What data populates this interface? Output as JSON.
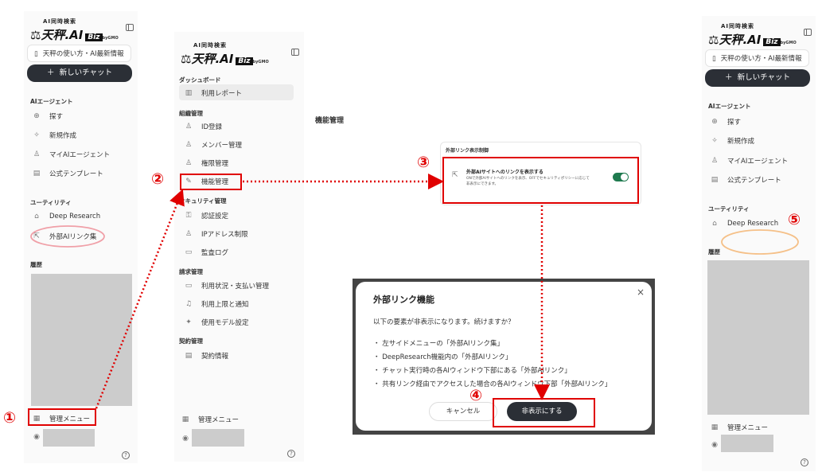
{
  "brand": {
    "small": "AI同時検索",
    "main": "天秤.AI",
    "biz": "Biz",
    "gmo": "byGMO"
  },
  "sidebar": {
    "usage_link": "天秤の使い方・AI最新情報",
    "new_chat": "新しいチャット",
    "sec_agents": "AIエージェント",
    "agents": [
      "探す",
      "新規作成",
      "マイAIエージェント",
      "公式テンプレート"
    ],
    "sec_utility": "ユーティリティ",
    "utilities": [
      "Deep Research",
      "外部AIリンク集"
    ],
    "sec_history": "履歴",
    "admin_menu": "管理メニュー",
    "help": "?"
  },
  "admin": {
    "sec_dashboard": "ダッシュボード",
    "usage_report": "利用レポート",
    "sec_org": "組織管理",
    "org_items": [
      "ID登録",
      "メンバー管理",
      "権限管理",
      "機能管理"
    ],
    "sec_security": "セキュリティ管理",
    "security_items": [
      "認証設定",
      "IPアドレス制限",
      "監査ログ"
    ],
    "sec_billing": "請求管理",
    "billing_items": [
      "利用状況・支払い管理",
      "利用上限と通知",
      "使用モデル設定"
    ],
    "sec_contract": "契約管理",
    "contract_items": [
      "契約情報"
    ],
    "admin_menu": "管理メニュー"
  },
  "feature": {
    "page_title": "機能管理",
    "card_title": "外部リンク表示制御",
    "setting_title": "外部AIサイトへのリンクを表示する",
    "setting_desc_1": "ONで外部AIサイトへのリンクを表示、OFFでセキュリティポリシーに応じて",
    "setting_desc_2": "非表示にできます。"
  },
  "modal": {
    "title": "外部リンク機能",
    "message": "以下の要素が非表示になります。続けますか？",
    "bullets": [
      "・ 左サイドメニューの「外部AIリンク集」",
      "・ DeepResearch機能内の「外部AIリンク」",
      "・ チャット実行時の各AIウィンドウ下部にある「外部AIリンク」",
      "・ 共有リンク経由でアクセスした場合の各AIウィンドウ下部「外部AIリンク」"
    ],
    "close": "×",
    "cancel": "キャンセル",
    "confirm": "非表示にする"
  },
  "steps": [
    "①",
    "②",
    "③",
    "④",
    "⑤"
  ],
  "colors": {
    "annotation_red": "#e00000",
    "toggle_on": "#1f7a4f",
    "dark_button": "#2b2f36",
    "ellipse_pink": "#f0a0a8",
    "ellipse_orange": "#f5c088"
  },
  "icons": {
    "link": "external-link-icon",
    "search": "search-icon",
    "create": "sparkle-icon",
    "agent": "user-icon",
    "template": "template-icon",
    "deep_research": "flask-icon",
    "admin": "building-icon",
    "avatar": "avatar-icon"
  }
}
